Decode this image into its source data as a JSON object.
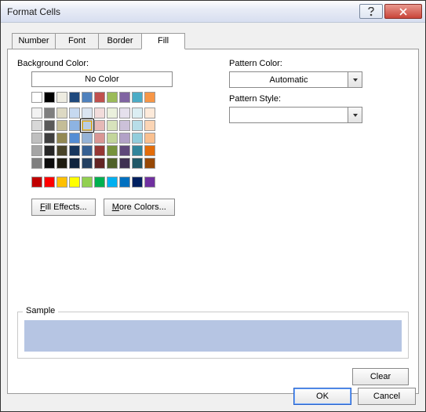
{
  "window": {
    "title": "Format Cells"
  },
  "tabs": {
    "number": "Number",
    "font": "Font",
    "border": "Border",
    "fill": "Fill"
  },
  "fill": {
    "bg_label": "Background Color:",
    "no_color": "No Color",
    "theme_row0": [
      "#ffffff",
      "#000000",
      "#eeece1",
      "#1f497d",
      "#4f81bd",
      "#c0504d",
      "#9bbb59",
      "#8064a2",
      "#4bacc6",
      "#f79646"
    ],
    "theme_shades": [
      [
        "#f2f2f2",
        "#7f7f7f",
        "#ddd9c3",
        "#c6d9f0",
        "#dbe5f1",
        "#f2dcdb",
        "#ebf1dd",
        "#e5e0ec",
        "#dbeef3",
        "#fdeada"
      ],
      [
        "#d8d8d8",
        "#595959",
        "#c4bd97",
        "#8db3e2",
        "#b8cce4",
        "#e5b9b7",
        "#d7e3bc",
        "#ccc1d9",
        "#b7dde8",
        "#fbd5b5"
      ],
      [
        "#bfbfbf",
        "#3f3f3f",
        "#938953",
        "#548dd4",
        "#95b3d7",
        "#d99694",
        "#c3d69b",
        "#b2a2c7",
        "#92cddc",
        "#fac08f"
      ],
      [
        "#a5a5a5",
        "#262626",
        "#494429",
        "#17365d",
        "#366092",
        "#953734",
        "#76923c",
        "#5f497a",
        "#31859b",
        "#e36c09"
      ],
      [
        "#7f7f7f",
        "#0c0c0c",
        "#1d1b10",
        "#0f243e",
        "#244061",
        "#632423",
        "#4f6128",
        "#3f3151",
        "#205867",
        "#974806"
      ]
    ],
    "selected": "#b8cce4",
    "standard": [
      "#c00000",
      "#ff0000",
      "#ffc000",
      "#ffff00",
      "#92d050",
      "#00b050",
      "#00b0f0",
      "#0070c0",
      "#002060",
      "#7030a0"
    ],
    "fill_effects": "Fill Effects...",
    "more_colors": "More Colors...",
    "pattern_color_label": "Pattern Color:",
    "pattern_color_value": "Automatic",
    "pattern_style_label": "Pattern Style:",
    "pattern_style_value": "",
    "sample_label": "Sample",
    "sample_color": "#b6c5e3",
    "clear": "Clear"
  },
  "footer": {
    "ok": "OK",
    "cancel": "Cancel"
  }
}
